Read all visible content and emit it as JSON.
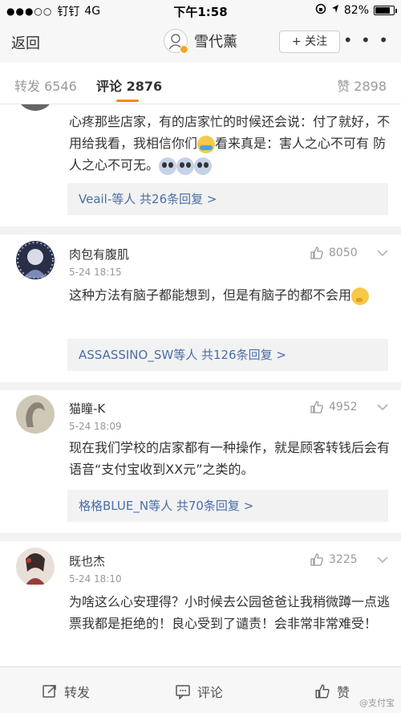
{
  "status_bar": {
    "carrier": "钉钉",
    "network": "4G",
    "time": "下午1:58",
    "battery": "82%",
    "battery_level": 0.82
  },
  "nav": {
    "back_label": "返回",
    "title": "雪代薰",
    "follow_label": "+ 关注",
    "more_label": "• • •"
  },
  "tabs": {
    "repost": "转发 6546",
    "comments": "评论 2876",
    "likes": "赞 2898"
  },
  "comments": [
    {
      "text_part1": "心疼那些店家，有的店家忙的时候还会说：付了就好，不用给我看，我相信你们",
      "text_part2": "看来真是：害人之心不可有 防人之心不可无。",
      "replies": "Veail-等人  共26条回复 >"
    },
    {
      "username": "肉包有腹肌",
      "time": "5-24 18:15",
      "likes": "8050",
      "text": "这种方法有脑子都能想到，但是有脑子的都不会用",
      "replies": "ASSASSINO_SW等人  共126条回复 >"
    },
    {
      "username": "猫瞳-K",
      "time": "5-24 18:09",
      "likes": "4952",
      "text": "现在我们学校的店家都有一种操作，就是顾客转钱后会有语音“支付宝收到XX元”之类的。",
      "replies": "格格BLUE_N等人  共70条回复 >"
    },
    {
      "username": "既也杰",
      "time": "5-24 18:10",
      "likes": "3225",
      "text": "为啥这么心安理得？小时候去公园爸爸让我稍微蹲一点逃票我都是拒绝的！良心受到了谴责！会非常非常难受！"
    }
  ],
  "bottom_bar": {
    "repost": "转发",
    "comment": "评论",
    "like": "赞",
    "watermark": "@支付宝"
  },
  "colors": {
    "accent": "#f28a1a",
    "link": "#4a6ea8"
  }
}
